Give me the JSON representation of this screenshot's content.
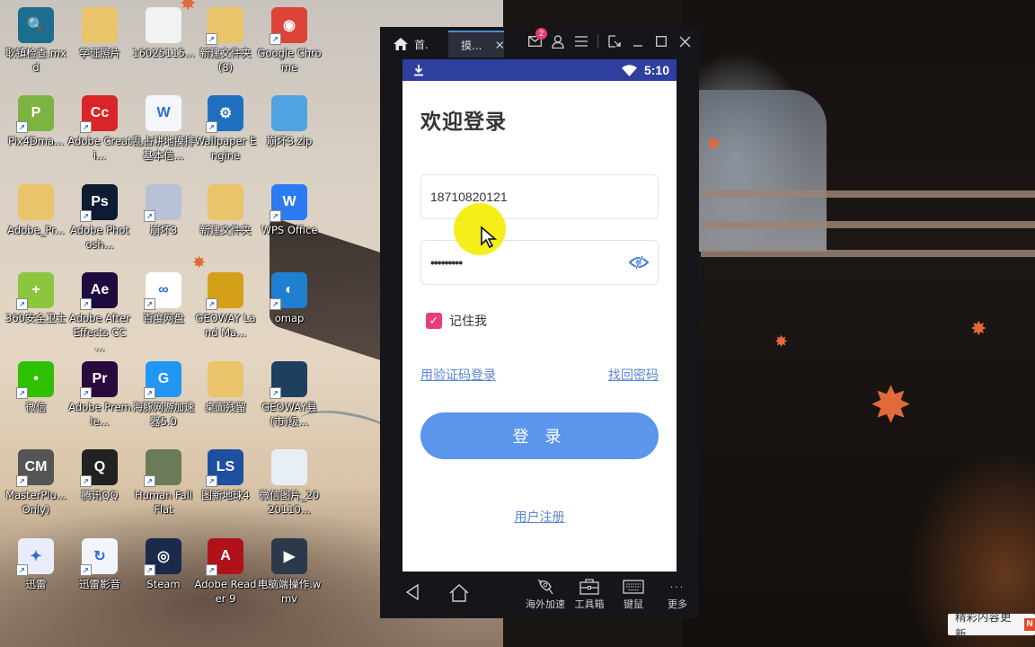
{
  "desktop": {
    "icons": [
      {
        "label": "耿镇检查.mxd",
        "glyph": "🔍",
        "color": "#1d6e8c",
        "shortcut": false
      },
      {
        "label": "学证照片",
        "glyph": "",
        "color": "#e9c46a",
        "shortcut": false
      },
      {
        "label": "16025115...",
        "glyph": "",
        "color": "#f2f2f2",
        "shortcut": false
      },
      {
        "label": "新建文件夹 (8)",
        "glyph": "",
        "color": "#e9c46a",
        "shortcut": true
      },
      {
        "label": "Google Chrome",
        "glyph": "◉",
        "color": "#db4437",
        "shortcut": true
      },
      {
        "label": "Pix4Dma...",
        "glyph": "P",
        "color": "#7cb342",
        "shortcut": true
      },
      {
        "label": "Adobe Creati...",
        "glyph": "Cc",
        "color": "#d9252a",
        "shortcut": true
      },
      {
        "label": "乱占耕地摸排基本信...",
        "glyph": "W",
        "color": "#f4f6fb",
        "shortcut": false
      },
      {
        "label": "Wallpaper Engine",
        "glyph": "⚙",
        "color": "#1f6fc1",
        "shortcut": true
      },
      {
        "label": "崩坏3.zip",
        "glyph": "",
        "color": "#4fa3e0",
        "shortcut": false
      },
      {
        "label": "Adobe_Pr...",
        "glyph": "",
        "color": "#e9c46a",
        "shortcut": false
      },
      {
        "label": "Adobe Photosh...",
        "glyph": "Ps",
        "color": "#0d1c33",
        "shortcut": true
      },
      {
        "label": "崩坏3",
        "glyph": "",
        "color": "#b8c2d6",
        "shortcut": true
      },
      {
        "label": "新建文件夹",
        "glyph": "",
        "color": "#e9c46a",
        "shortcut": false
      },
      {
        "label": "WPS Office",
        "glyph": "W",
        "color": "#2b7bf2",
        "shortcut": true
      },
      {
        "label": "360安全卫士",
        "glyph": "+",
        "color": "#8cc63f",
        "shortcut": true
      },
      {
        "label": "Adobe After Effects CC ...",
        "glyph": "Ae",
        "color": "#1e0a3c",
        "shortcut": true
      },
      {
        "label": "百度网盘",
        "glyph": "∞",
        "color": "#ffffff",
        "shortcut": true
      },
      {
        "label": "GEOWAY Land Ma...",
        "glyph": "",
        "color": "#d4a017",
        "shortcut": true
      },
      {
        "label": "omap",
        "glyph": "◐",
        "color": "#1f7fd1",
        "shortcut": true
      },
      {
        "label": "微信",
        "glyph": "•",
        "color": "#2dc100",
        "shortcut": true
      },
      {
        "label": "Adobe Premie...",
        "glyph": "Pr",
        "color": "#2a0a3c",
        "shortcut": true
      },
      {
        "label": "海豚网游加速器5.0",
        "glyph": "G",
        "color": "#2196f3",
        "shortcut": true
      },
      {
        "label": "桌面残留",
        "glyph": "",
        "color": "#e9c46a",
        "shortcut": false
      },
      {
        "label": "GEOWAY县(市)级...",
        "glyph": "",
        "color": "#1f3f5f",
        "shortcut": true
      },
      {
        "label": "MasterPlu... Only)",
        "glyph": "CM",
        "color": "#555555",
        "shortcut": true
      },
      {
        "label": "腾讯QQ",
        "glyph": "Q",
        "color": "#222222",
        "shortcut": true
      },
      {
        "label": "Human Fall Flat",
        "glyph": "",
        "color": "#6b7b5a",
        "shortcut": true
      },
      {
        "label": "图新地球4",
        "glyph": "LS",
        "color": "#1f4fa0",
        "shortcut": true
      },
      {
        "label": "微信图片_2020110...",
        "glyph": "",
        "color": "#e8eef6",
        "shortcut": false
      },
      {
        "label": "迅雷",
        "glyph": "✦",
        "color": "#e9ecfb",
        "shortcut": true
      },
      {
        "label": "迅雷影音",
        "glyph": "↻",
        "color": "#f2f5ff",
        "shortcut": true
      },
      {
        "label": "Steam",
        "glyph": "◎",
        "color": "#1b2a4a",
        "shortcut": true
      },
      {
        "label": "Adobe Reader 9",
        "glyph": "A",
        "color": "#b0121a",
        "shortcut": true
      },
      {
        "label": "电脑端操作.wmv",
        "glyph": "▶",
        "color": "#2a3a4a",
        "shortcut": false
      }
    ]
  },
  "emulator": {
    "tabs": [
      {
        "label": "首.",
        "icon": "home-icon"
      },
      {
        "label": "摸...",
        "icon": "close-icon"
      }
    ],
    "mail_badge": "2",
    "statusbar": {
      "time": "5:10"
    },
    "app": {
      "title": "欢迎登录",
      "phone_value": "18710820121",
      "password_value": "•••••••••",
      "remember_label": "记住我",
      "remember_checked": true,
      "sms_login_link": "用验证码登录",
      "forgot_link": "找回密码",
      "login_button": "登 录",
      "register_link": "用户注册"
    },
    "toolbar": {
      "accelerate": "海外加速",
      "toolbox": "工具箱",
      "keymouse": "键鼠",
      "more": "更多"
    }
  },
  "notification": {
    "text": "精彩内容更新",
    "badge": "N"
  },
  "colors": {
    "statusbar": "#2f3f9e",
    "primary_button": "#5b95ec",
    "link": "#5a86d6",
    "checkbox": "#e83d7d"
  }
}
